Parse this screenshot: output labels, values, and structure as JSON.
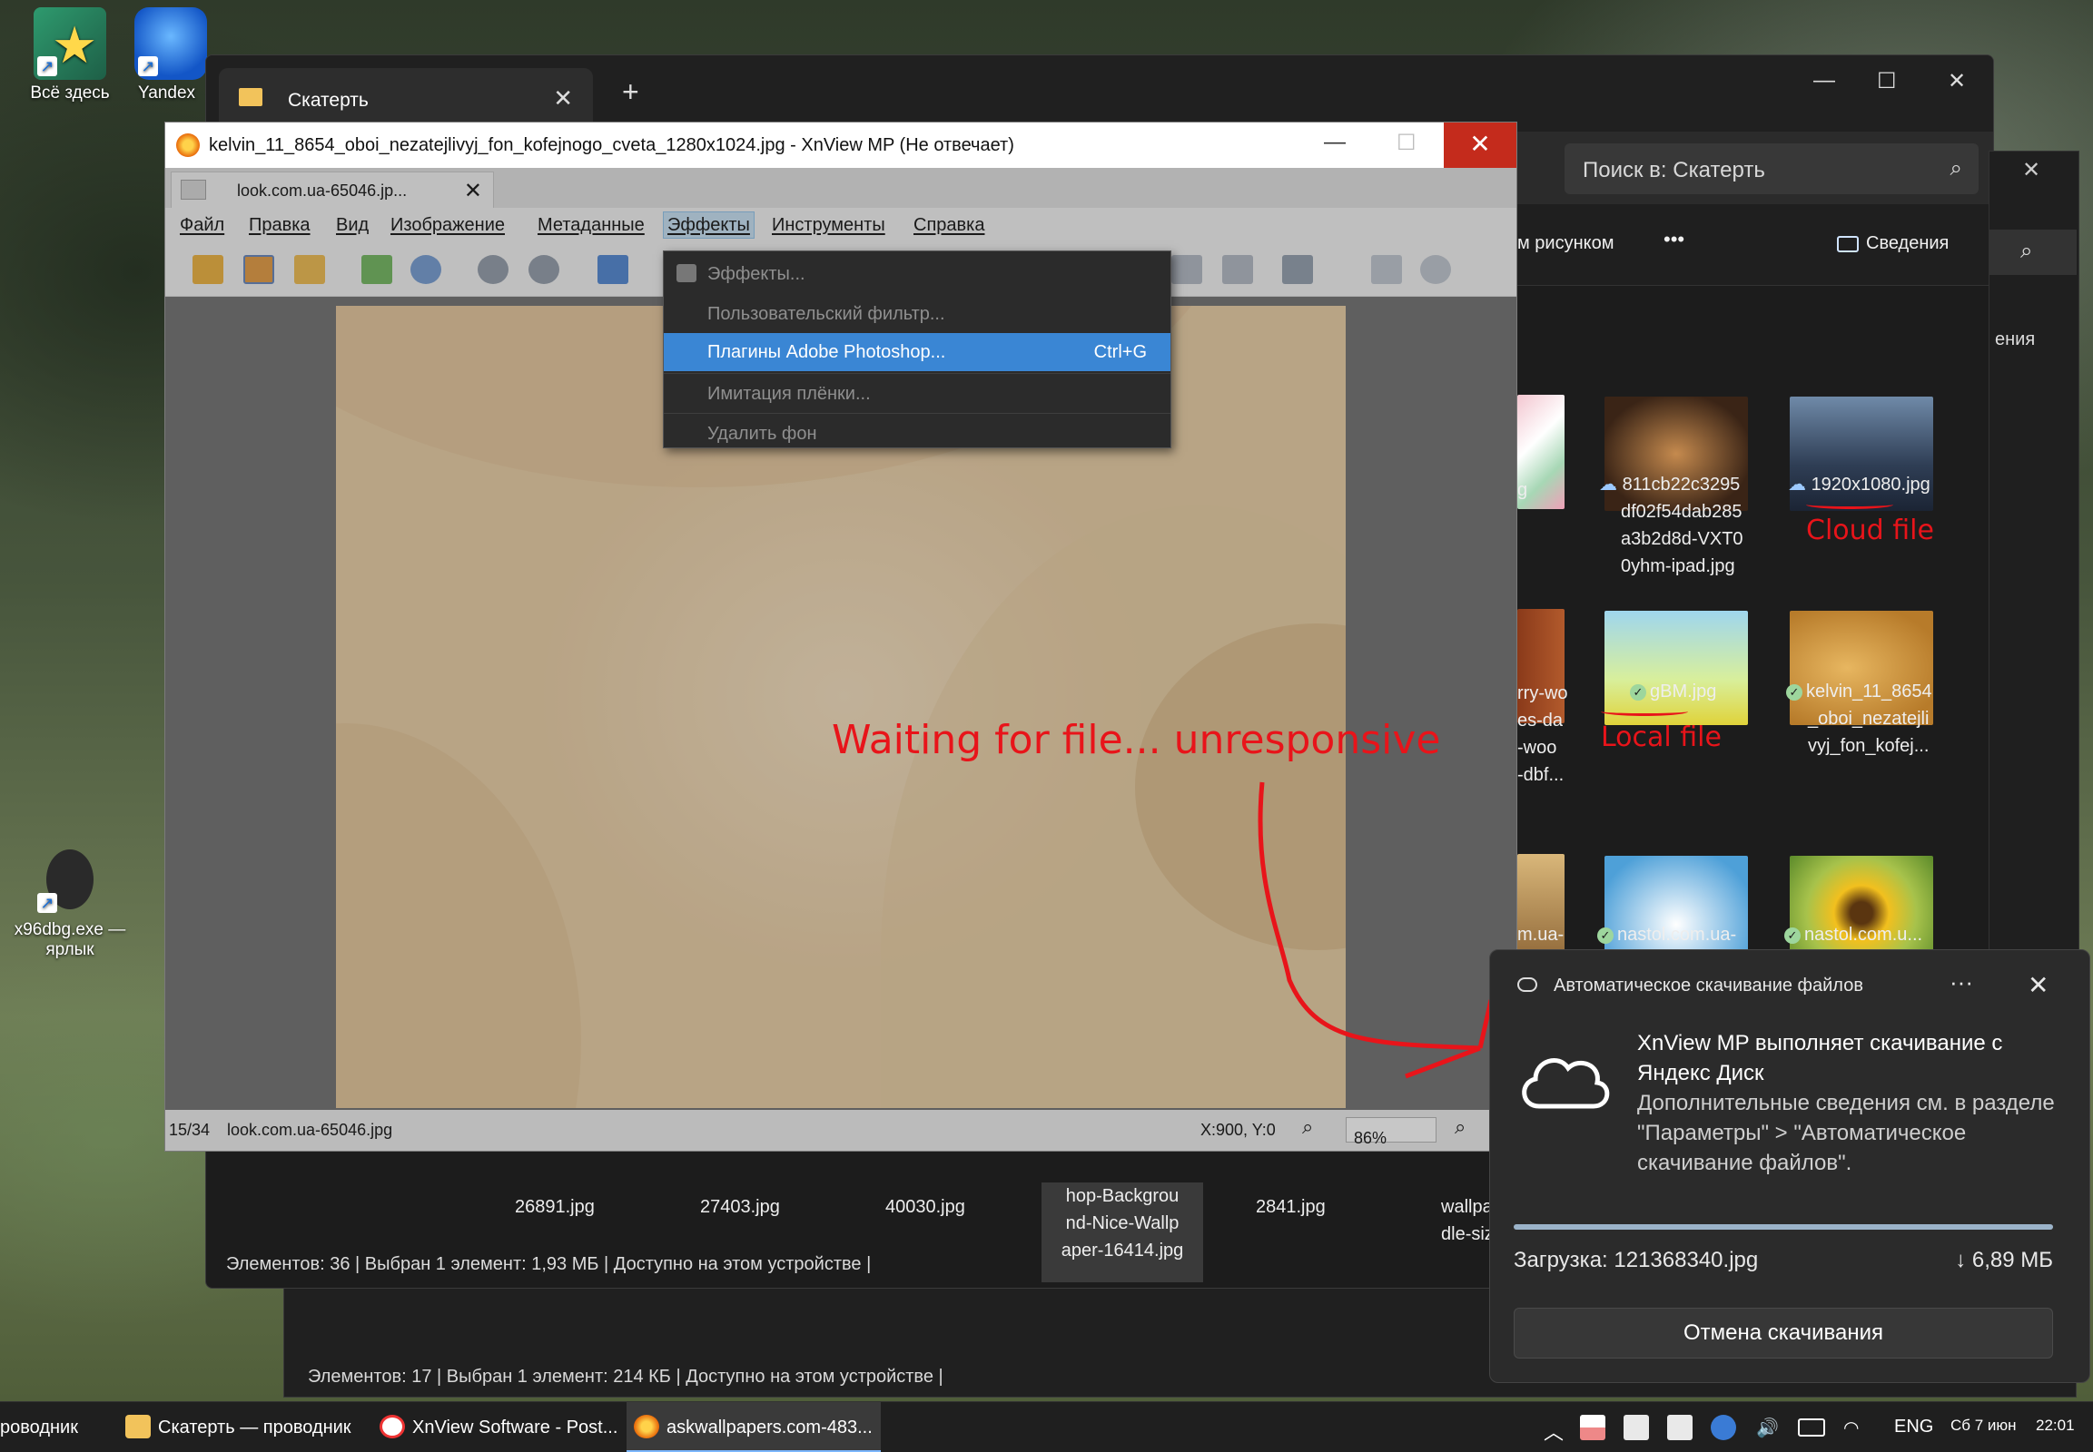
{
  "desktop": {
    "icons": [
      {
        "label": "Всё здесь"
      },
      {
        "label": "Yandex"
      },
      {
        "label": "x96dbg.exe — ярлык"
      }
    ]
  },
  "explorer_back": {
    "status": "Элементов: 17  |  Выбран 1 элемент: 214 КБ  |  Доступно на этом устройстве  |"
  },
  "explorer": {
    "tab_title": "Скатерть",
    "search_placeholder": "Поиск в: Скатерть",
    "cmd_partial": "м рисунком",
    "cmd_more": "•••",
    "cmd_details": "Сведения",
    "side_partial": "ения",
    "files": [
      {
        "name": "g",
        "status": ""
      },
      {
        "name": "811cb22c3295df02f54dab285a3b2d8d-VXT00yhm-ipad.jpg",
        "lines": [
          "811cb22c3295",
          "df02f54dab285",
          "a3b2d8d-VXT0",
          "0yhm-ipad.jpg"
        ],
        "status": "cloud"
      },
      {
        "name": "1920x1080.jpg",
        "status": "cloud"
      },
      {
        "name": "rry-wo",
        "lines": [
          "rry-wo",
          "es-da",
          "-woo",
          "-dbf..."
        ],
        "status": ""
      },
      {
        "name": "gBM.jpg",
        "status": "local"
      },
      {
        "name": "kelvin_11_8654_oboi_nezatejlivyj_fon_kofej...",
        "lines": [
          "kelvin_11_8654",
          "_oboi_nezatejli",
          "vyj_fon_kofej..."
        ],
        "status": "local"
      },
      {
        "name": "m.ua-",
        "status": ""
      },
      {
        "name": "nastol.com.ua-",
        "status": "local"
      },
      {
        "name": "nastol.com.u...",
        "status": "local"
      }
    ],
    "lower_files": [
      "26891.jpg",
      "27403.jpg",
      "40030.jpg",
      "hop-Backgrou nd-Nice-Wallp aper-16414.jpg",
      "2841.jpg",
      "wallpa dle-siz"
    ],
    "lower_lines": {
      "f4": [
        "hop-Backgrou",
        "nd-Nice-Wallp",
        "aper-16414.jpg"
      ],
      "f6": [
        "wallpa",
        "dle-siz"
      ]
    },
    "status": "Элементов: 36  |  Выбран 1 элемент: 1,93 МБ  |  Доступно на этом устройстве  |"
  },
  "annotations": {
    "cloud_file": "Cloud file",
    "local_file": "Local file",
    "waiting": "Waiting for file... unresponsive",
    "color": "#e8141a"
  },
  "xnview": {
    "title": "kelvin_11_8654_oboi_nezatejlivyj_fon_kofejnogo_cveta_1280x1024.jpg - XnView MP (Не отвечает)",
    "tab_label": "look.com.ua-65046.jp...",
    "menu": [
      "Файл",
      "Правка",
      "Вид",
      "Изображение",
      "Метаданные",
      "Эффекты",
      "Инструменты",
      "Справка"
    ],
    "active_menu": "Эффекты",
    "status_index": "15/34",
    "status_file": "look.com.ua-65046.jpg",
    "status_coords": "X:900, Y:0",
    "zoom": "86%",
    "dropdown": [
      {
        "label": "Эффекты...",
        "shortcut": "",
        "selected": false
      },
      {
        "label": "Пользовательский фильтр...",
        "shortcut": "",
        "selected": false
      },
      {
        "label": "Плагины Adobe Photoshop...",
        "shortcut": "Ctrl+G",
        "selected": true
      },
      {
        "label": "Имитация плёнки...",
        "shortcut": "",
        "selected": false
      },
      {
        "label": "Удалить фон",
        "shortcut": "",
        "selected": false
      }
    ]
  },
  "toast": {
    "header": "Автоматическое скачивание файлов",
    "more": "···",
    "title": "XnView MP выполняет скачивание с Яндекс Диск",
    "body": "Дополнительные сведения см. в разделе \"Параметры\" > \"Автоматическое скачивание файлов\".",
    "download_label": "Загрузка: 121368340.jpg",
    "size": "↓ 6,89 МБ",
    "cancel": "Отмена скачивания"
  },
  "taskbar": {
    "items": [
      "роводник",
      "Скатерть — проводник",
      "XnView Software - Post...",
      "askwallpapers.com-483..."
    ],
    "lang": "ENG",
    "date": "Сб 7 июн",
    "time": "22:01"
  }
}
